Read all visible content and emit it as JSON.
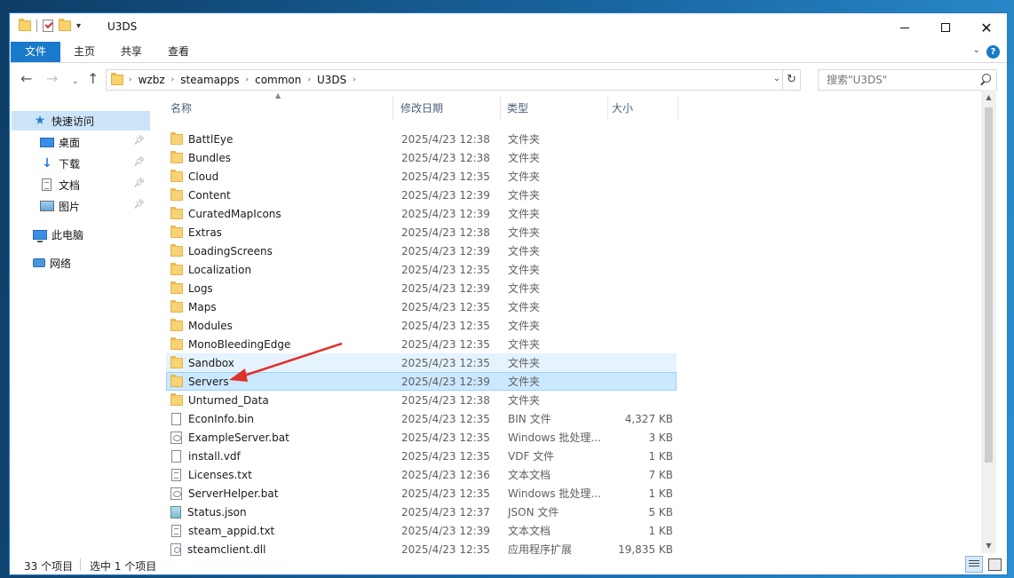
{
  "window": {
    "title": "U3DS",
    "quick_access_dropdown": "▾"
  },
  "ribbon": {
    "tabs": [
      {
        "label": "文件"
      },
      {
        "label": "主页"
      },
      {
        "label": "共享"
      },
      {
        "label": "查看"
      }
    ],
    "help": "?"
  },
  "address": {
    "crumbs": [
      "wzbz",
      "steamapps",
      "common",
      "U3DS"
    ]
  },
  "search": {
    "placeholder": "搜索\"U3DS\""
  },
  "nav_pane": {
    "quick_access": "快速访问",
    "items": [
      {
        "label": "桌面",
        "icon": "desktop-icon"
      },
      {
        "label": "下载",
        "icon": "download-icon"
      },
      {
        "label": "文档",
        "icon": "documents-icon"
      },
      {
        "label": "图片",
        "icon": "pictures-icon"
      }
    ],
    "this_pc": "此电脑",
    "network": "网络"
  },
  "columns": {
    "name": "名称",
    "date": "修改日期",
    "type": "类型",
    "size": "大小"
  },
  "files": [
    {
      "name": "BattlEye",
      "date": "2025/4/23 12:38",
      "type": "文件夹",
      "size": "",
      "icon": "folder"
    },
    {
      "name": "Bundles",
      "date": "2025/4/23 12:38",
      "type": "文件夹",
      "size": "",
      "icon": "folder"
    },
    {
      "name": "Cloud",
      "date": "2025/4/23 12:35",
      "type": "文件夹",
      "size": "",
      "icon": "folder"
    },
    {
      "name": "Content",
      "date": "2025/4/23 12:39",
      "type": "文件夹",
      "size": "",
      "icon": "folder"
    },
    {
      "name": "CuratedMapIcons",
      "date": "2025/4/23 12:39",
      "type": "文件夹",
      "size": "",
      "icon": "folder"
    },
    {
      "name": "Extras",
      "date": "2025/4/23 12:38",
      "type": "文件夹",
      "size": "",
      "icon": "folder"
    },
    {
      "name": "LoadingScreens",
      "date": "2025/4/23 12:39",
      "type": "文件夹",
      "size": "",
      "icon": "folder"
    },
    {
      "name": "Localization",
      "date": "2025/4/23 12:35",
      "type": "文件夹",
      "size": "",
      "icon": "folder"
    },
    {
      "name": "Logs",
      "date": "2025/4/23 12:39",
      "type": "文件夹",
      "size": "",
      "icon": "folder"
    },
    {
      "name": "Maps",
      "date": "2025/4/23 12:35",
      "type": "文件夹",
      "size": "",
      "icon": "folder"
    },
    {
      "name": "Modules",
      "date": "2025/4/23 12:35",
      "type": "文件夹",
      "size": "",
      "icon": "folder"
    },
    {
      "name": "MonoBleedingEdge",
      "date": "2025/4/23 12:35",
      "type": "文件夹",
      "size": "",
      "icon": "folder"
    },
    {
      "name": "Sandbox",
      "date": "2025/4/23 12:35",
      "type": "文件夹",
      "size": "",
      "icon": "folder",
      "state": "hover"
    },
    {
      "name": "Servers",
      "date": "2025/4/23 12:39",
      "type": "文件夹",
      "size": "",
      "icon": "folder",
      "state": "selected"
    },
    {
      "name": "Unturned_Data",
      "date": "2025/4/23 12:38",
      "type": "文件夹",
      "size": "",
      "icon": "folder"
    },
    {
      "name": "EconInfo.bin",
      "date": "2025/4/23 12:35",
      "type": "BIN 文件",
      "size": "4,327 KB",
      "icon": "file"
    },
    {
      "name": "ExampleServer.bat",
      "date": "2025/4/23 12:35",
      "type": "Windows 批处理...",
      "size": "3 KB",
      "icon": "bat"
    },
    {
      "name": "install.vdf",
      "date": "2025/4/23 12:35",
      "type": "VDF 文件",
      "size": "1 KB",
      "icon": "file"
    },
    {
      "name": "Licenses.txt",
      "date": "2025/4/23 12:36",
      "type": "文本文档",
      "size": "7 KB",
      "icon": "txt"
    },
    {
      "name": "ServerHelper.bat",
      "date": "2025/4/23 12:35",
      "type": "Windows 批处理...",
      "size": "1 KB",
      "icon": "bat"
    },
    {
      "name": "Status.json",
      "date": "2025/4/23 12:37",
      "type": "JSON 文件",
      "size": "5 KB",
      "icon": "json"
    },
    {
      "name": "steam_appid.txt",
      "date": "2025/4/23 12:39",
      "type": "文本文档",
      "size": "1 KB",
      "icon": "txt"
    },
    {
      "name": "steamclient.dll",
      "date": "2025/4/23 12:35",
      "type": "应用程序扩展",
      "size": "19,835 KB",
      "icon": "dll"
    }
  ],
  "status": {
    "count": "33 个项目",
    "selected": "选中 1 个项目"
  },
  "colors": {
    "accent": "#1979ca",
    "selection": "#cce8ff",
    "annotation_arrow": "#e0302a"
  }
}
